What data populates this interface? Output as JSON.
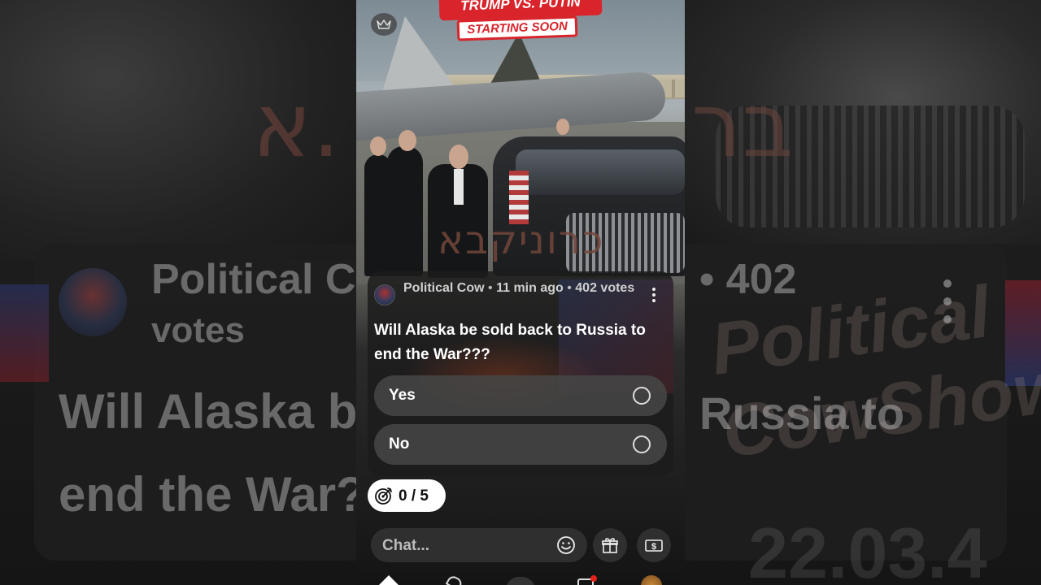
{
  "video": {
    "banner_top": "TRUMP VS. PUTIN",
    "banner_bottom": "STARTING SOON",
    "watermark": "כרוניקבא"
  },
  "background": {
    "channel_partial": "Political C",
    "votes_partial": "• 402",
    "votes_word": "votes",
    "question_left_1": "Will Alaska b",
    "question_left_2": "end the War?",
    "question_right": "Russia to",
    "brand_overlay": "Political CowShow",
    "timestamp_overlay": "22.03.4"
  },
  "poll": {
    "channel": "Political Cow",
    "age": "11 min ago",
    "votes": "402 votes",
    "question": "Will Alaska be sold back to Russia to end the War???",
    "options": [
      {
        "label": "Yes"
      },
      {
        "label": "No"
      }
    ]
  },
  "goal": {
    "progress_text": "0 / 5",
    "current": 0,
    "target": 5
  },
  "chat": {
    "placeholder": "Chat..."
  },
  "icons": {
    "crown": "crown-icon",
    "menu": "more-vert-icon",
    "target": "target-icon",
    "emoji": "emoji-icon",
    "gift": "gift-icon",
    "cash": "cash-icon"
  },
  "colors": {
    "banner_red": "#d8242a",
    "notification_dot": "#e62117"
  }
}
